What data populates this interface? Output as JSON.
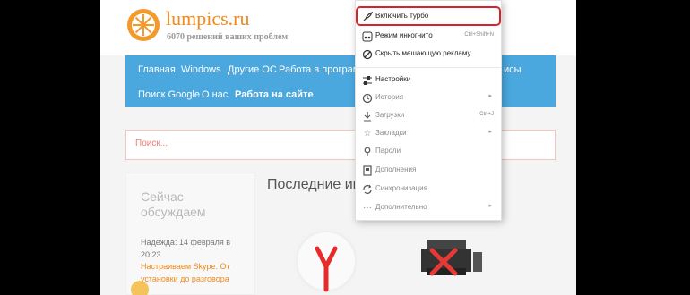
{
  "site": {
    "title": "lumpics.ru",
    "subtitle": "6070 решений ваших проблем"
  },
  "nav": {
    "items": [
      "Главная",
      "Windows",
      "Другие ОС",
      "Работа в программа",
      "исы",
      "Поиск Google",
      "О нас",
      "Работа на сайте"
    ]
  },
  "search": {
    "placeholder": "Поиск..."
  },
  "sidebar": {
    "title": "Сейчас обсуждаем",
    "comment_author": "Надежда: 14 февраля в 20:23",
    "comment_link": "Настраиваем Skype. От установки до разговора"
  },
  "main": {
    "latest_title": "Последние ин"
  },
  "menu": {
    "items": [
      {
        "icon": "rocket-icon",
        "label": "Включить турбо",
        "shortcut": "",
        "arrow": false
      },
      {
        "icon": "incognito-icon",
        "label": "Режим инкогнито",
        "shortcut": "Ctrl+Shift+N",
        "arrow": false
      },
      {
        "icon": "block-icon",
        "label": "Скрыть мешающую рекламу",
        "shortcut": "",
        "arrow": false
      },
      {
        "icon": "sliders-icon",
        "label": "Настройки",
        "shortcut": "",
        "arrow": false
      },
      {
        "icon": "clock-icon",
        "label": "История",
        "shortcut": "",
        "arrow": true
      },
      {
        "icon": "download-icon",
        "label": "Загрузки",
        "shortcut": "Ctrl+J",
        "arrow": false
      },
      {
        "icon": "star-icon",
        "label": "Закладки",
        "shortcut": "",
        "arrow": true
      },
      {
        "icon": "key-icon",
        "label": "Пароли",
        "shortcut": "",
        "arrow": false
      },
      {
        "icon": "addons-icon",
        "label": "Дополнения",
        "shortcut": "",
        "arrow": false
      },
      {
        "icon": "sync-icon",
        "label": "Синхронизация",
        "shortcut": "",
        "arrow": false
      },
      {
        "icon": "more-icon",
        "label": "Дополнительно",
        "shortcut": "",
        "arrow": true
      }
    ]
  },
  "colors": {
    "nav_bg": "#4aa8de",
    "accent_orange": "#f08a1c",
    "highlight_red": "#d7222a"
  }
}
